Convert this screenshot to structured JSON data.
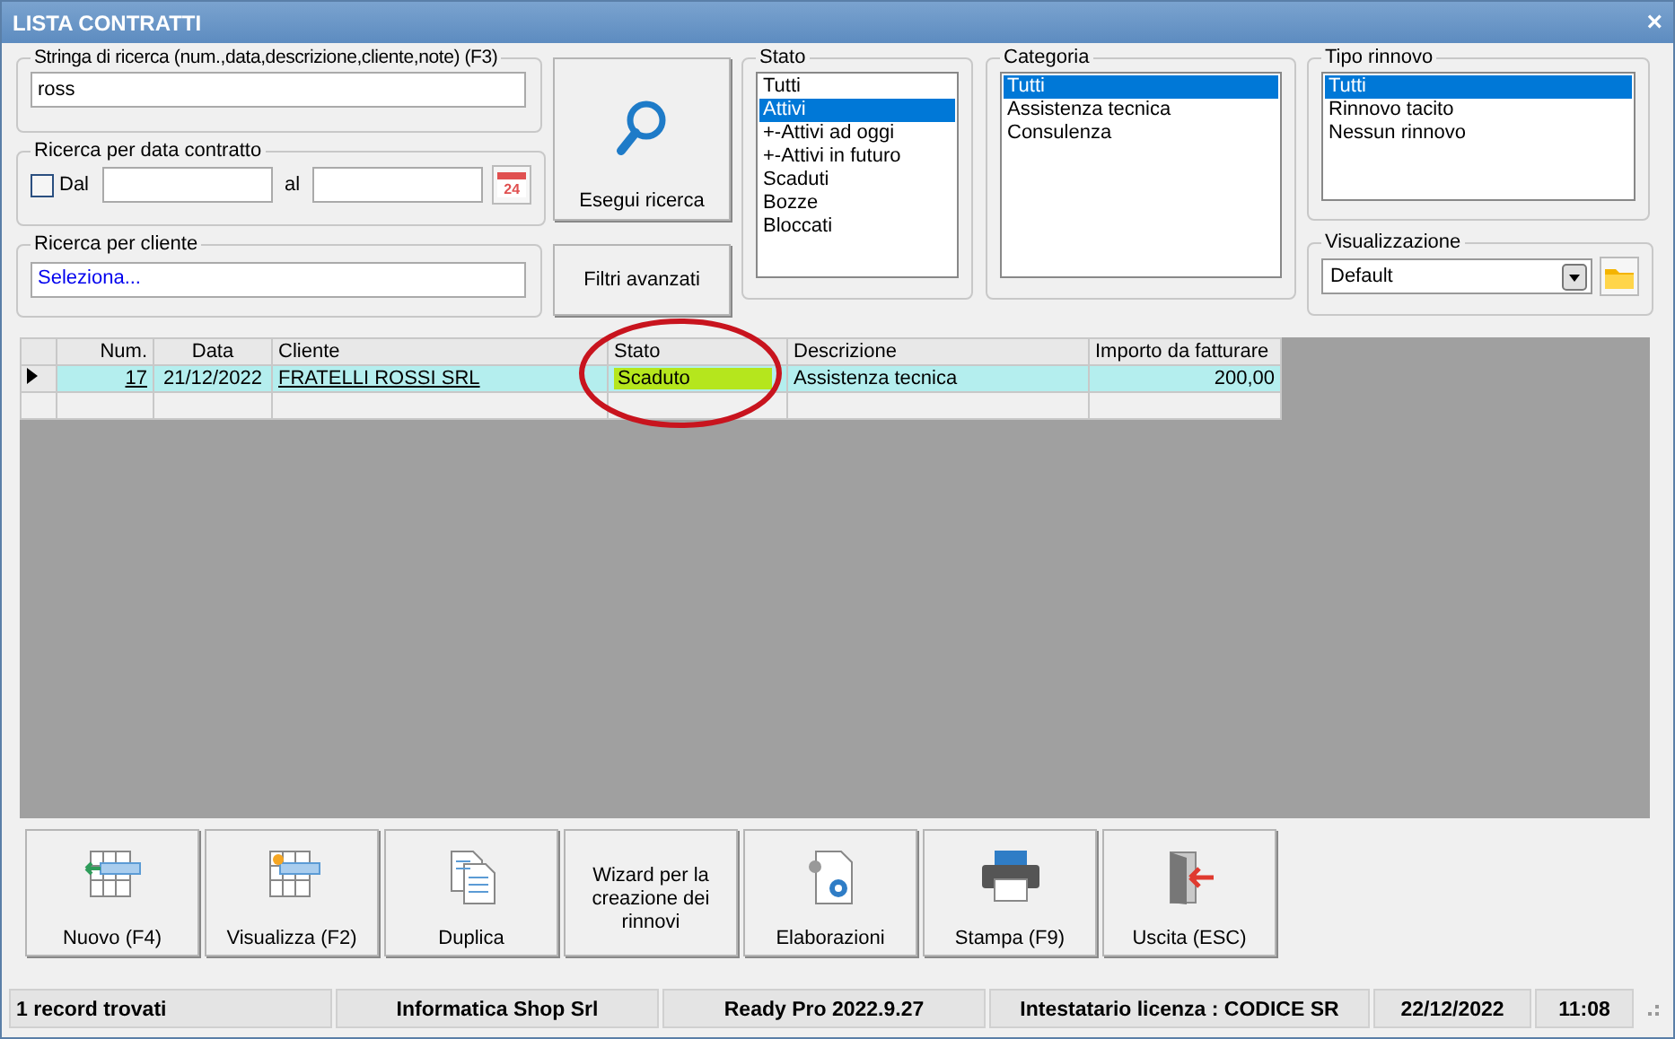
{
  "window": {
    "title": "LISTA CONTRATTI",
    "close": "×"
  },
  "search": {
    "label": "Stringa di ricerca (num.,data,descrizione,cliente,note) (F3)",
    "value": "ross"
  },
  "date_filter": {
    "label": "Ricerca per data contratto",
    "checkbox_label": "Dal",
    "checked": false,
    "to_label": "al",
    "calendar_day": "24"
  },
  "client_filter": {
    "label": "Ricerca per cliente",
    "value": "Seleziona..."
  },
  "search_button": "Esegui ricerca",
  "advanced_button": "Filtri avanzati",
  "filters": [
    {
      "label": "Stato",
      "items": [
        {
          "text": "Tutti",
          "selected": false
        },
        {
          "text": "Attivi",
          "selected": true
        },
        {
          "text": "+-Attivi ad oggi",
          "selected": false
        },
        {
          "text": "+-Attivi in futuro",
          "selected": false
        },
        {
          "text": "Scaduti",
          "selected": false
        },
        {
          "text": "Bozze",
          "selected": false
        },
        {
          "text": "Bloccati",
          "selected": false
        }
      ]
    },
    {
      "label": "Categoria",
      "items": [
        {
          "text": "Tutti",
          "selected": true
        },
        {
          "text": "Assistenza tecnica",
          "selected": false
        },
        {
          "text": "Consulenza",
          "selected": false
        }
      ]
    },
    {
      "label": "Tipo rinnovo",
      "items": [
        {
          "text": "Tutti",
          "selected": true
        },
        {
          "text": "Rinnovo tacito",
          "selected": false
        },
        {
          "text": "Nessun rinnovo",
          "selected": false
        }
      ]
    }
  ],
  "view": {
    "label": "Visualizzazione",
    "value": "Default"
  },
  "table": {
    "columns": [
      "Num.",
      "Data",
      "Cliente",
      "Stato",
      "Descrizione",
      "Importo da fatturare"
    ],
    "rows": [
      {
        "selected": true,
        "num": "17",
        "data": "21/12/2022",
        "cliente": "FRATELLI ROSSI SRL",
        "stato": "Scaduto",
        "color": "#b5e61d",
        "descrizione": "Assistenza tecnica",
        "importo": "200,00"
      }
    ]
  },
  "actions": [
    {
      "label": "Nuovo (F4)",
      "kind": "new"
    },
    {
      "label": "Visualizza (F2)",
      "kind": "view"
    },
    {
      "label": "Duplica",
      "kind": "copy"
    },
    {
      "label": "Wizard per la creazione dei rinnovi",
      "kind": "text"
    },
    {
      "label": "Elaborazioni",
      "kind": "process"
    },
    {
      "label": "Stampa (F9)",
      "kind": "print"
    },
    {
      "label": "Uscita (ESC)",
      "kind": "exit"
    }
  ],
  "status_bar": [
    "1 record trovati",
    "Informatica Shop Srl",
    "Ready Pro 2022.9.27",
    "Intestatario licenza : CODICE SR",
    "22/12/2022",
    "11:08"
  ]
}
